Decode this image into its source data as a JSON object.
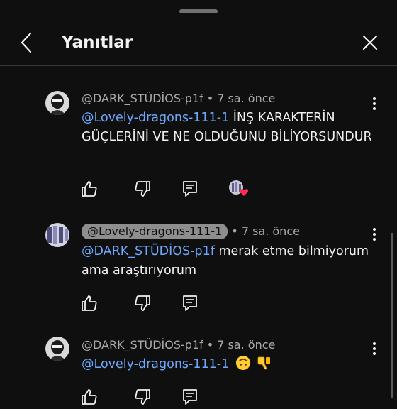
{
  "header": {
    "title": "Yanıtlar"
  },
  "comments": [
    {
      "author": "@DARK_STÜDİOS-p1f",
      "time": "7 sa. önce",
      "mention": "@Lovely-dragons-111-1",
      "text": " İNŞ KARAKTERİN GÜÇLERİNİ VE NE OLDUĞUNU BİLİYORSUNDUR"
    },
    {
      "author": "@Lovely-dragons-111-1",
      "time": "7 sa. önce",
      "mention": "@DARK_STÜDİOS-p1f",
      "text": " merak etme bilmiyorum ama araştırıyorum"
    },
    {
      "author": "@DARK_STÜDİOS-p1f",
      "time": "7 sa. önce",
      "mention": "@Lovely-dragons-111-1",
      "text": "",
      "emojis": [
        "upside-down-face-emoji",
        "thumbs-down-emoji"
      ]
    }
  ],
  "colors": {
    "background": "#0f0f0f",
    "mention": "#6ea8fe",
    "heart": "#ff2d55"
  },
  "icons": [
    "chevron-left-icon",
    "close-icon",
    "like-icon",
    "dislike-icon",
    "reply-icon",
    "more-vert-icon",
    "creator-heart-icon"
  ]
}
